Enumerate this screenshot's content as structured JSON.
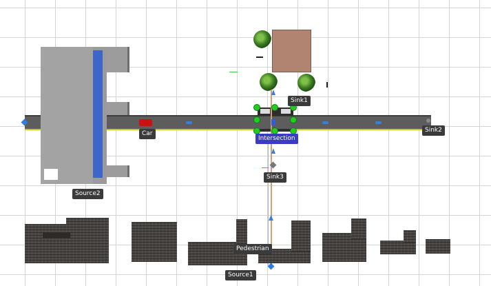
{
  "labels": {
    "sink1": "Sink1",
    "car": "Car",
    "intersection": "Intersection",
    "sink2": "Sink2",
    "sink3": "Sink3",
    "source2": "Source2",
    "pedestrian": "Pedestrian",
    "source1": "Source1"
  },
  "colors": {
    "grid": "#d4d4d4",
    "road": "#5a5a5a",
    "crosswalk": "#3b3cc4",
    "selection_handle": "#22cc22",
    "label_bg": "#3a3a3a",
    "selected_label_bg": "#3b3cc4",
    "car": "#cc1111"
  }
}
